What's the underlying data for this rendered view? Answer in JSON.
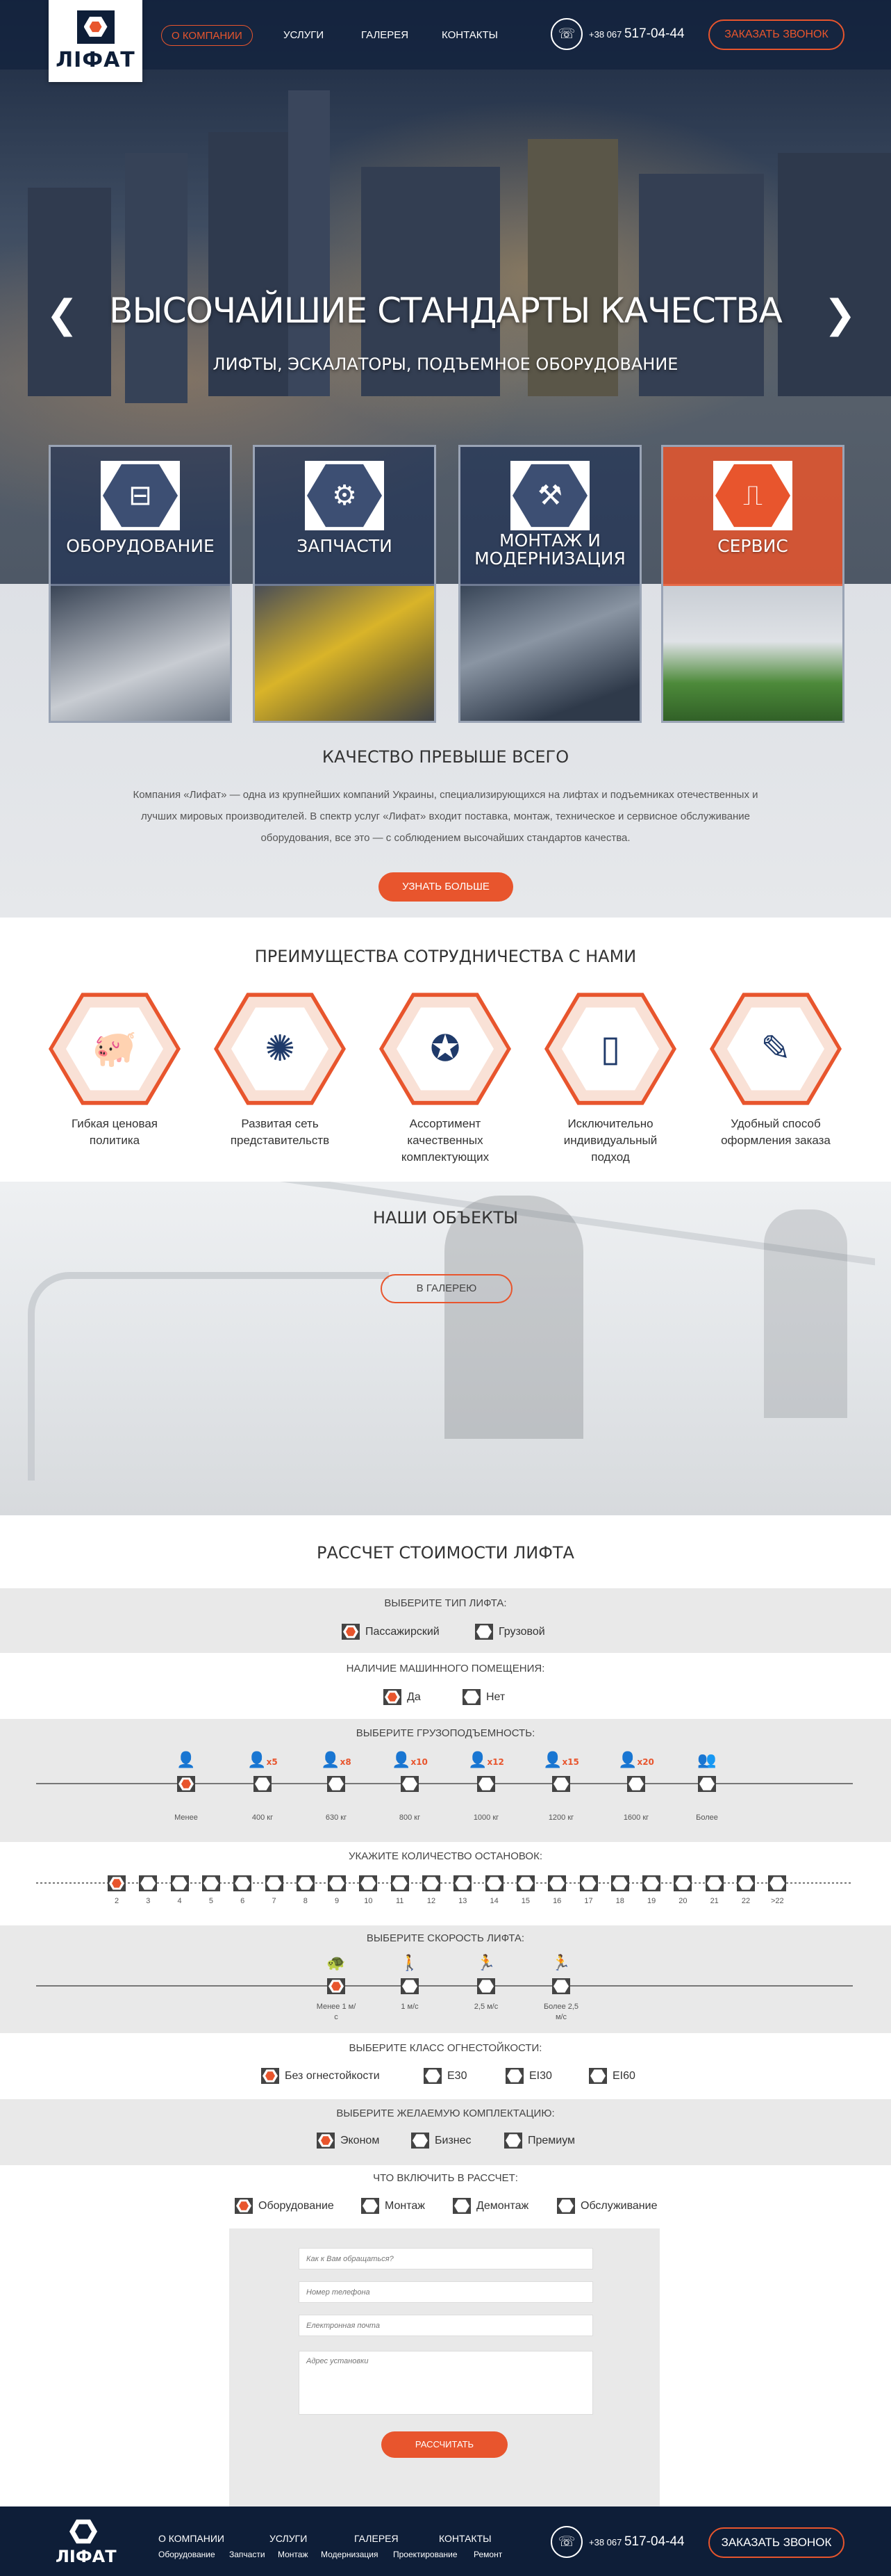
{
  "header": {
    "logo_text": "ЛІФАТ",
    "nav": [
      "О КОМПАНИИ",
      "УСЛУГИ",
      "ГАЛЕРЕЯ",
      "КОНТАКТЫ"
    ],
    "phone_prefix": "+38 067",
    "phone_number": "517-04-44",
    "call_button": "ЗАКАЗАТЬ ЗВОНОК"
  },
  "hero": {
    "title": "ВЫСОЧАЙШИЕ СТАНДАРТЫ КАЧЕСТВА",
    "subtitle": "ЛИФТЫ, ЭСКАЛАТОРЫ, ПОДЪЕМНОЕ ОБОРУДОВАНИЕ",
    "prev": "❮",
    "next": "❯"
  },
  "services": [
    {
      "label": "ОБОРУДОВАНИЕ",
      "icon": "elevator-icon"
    },
    {
      "label": "ЗАПЧАСТИ",
      "icon": "parts-icon"
    },
    {
      "label": "МОНТАЖ И МОДЕРНИЗАЦИЯ",
      "icon": "worker-icon"
    },
    {
      "label": "СЕРВИС",
      "icon": "multimeter-icon"
    }
  ],
  "quality": {
    "title": "КАЧЕСТВО ПРЕВЫШЕ ВСЕГО",
    "text": "Компания «Лифат» — одна из крупнейших компаний Украины, специализирующихся на лифтах и подъемниках отечественных и лучших мировых производителей. В спектр услуг «Лифат» входит поставка, монтаж, техническое и сервисное обслуживание оборудования, все это — с соблюдением высочайших стандартов качества.",
    "button": "УЗНАТЬ БОЛЬШЕ"
  },
  "advantages": {
    "title": "ПРЕИМУЩЕСТВА СОТРУДНИЧЕСТВА С НАМИ",
    "items": [
      {
        "label": "Гибкая ценовая политика",
        "icon": "piggy-bank-icon"
      },
      {
        "label": "Развитая сеть представительств",
        "icon": "network-icon"
      },
      {
        "label": "Ассортимент качественных комплектующих",
        "icon": "award-icon"
      },
      {
        "label": "Исключительно индивидуальный подход",
        "icon": "person-device-icon"
      },
      {
        "label": "Удобный способ оформления заказа",
        "icon": "document-pen-icon"
      }
    ]
  },
  "objects": {
    "title": "НАШИ ОБЪЕКТЫ",
    "button": "В ГАЛЕРЕЮ"
  },
  "calc": {
    "title": "РАССЧЕТ СТОИМОСТИ ЛИФТА",
    "type": {
      "label": "ВЫБЕРИТЕ ТИП ЛИФТА:",
      "options": [
        "Пассажирский",
        "Грузовой"
      ]
    },
    "machine_room": {
      "label": "НАЛИЧИЕ МАШИННОГО ПОМЕЩЕНИЯ:",
      "options": [
        "Да",
        "Нет"
      ]
    },
    "capacity": {
      "label": "ВЫБЕРИТЕ ГРУЗОПОДЪЕМНОСТЬ:",
      "ticks": [
        "Менее",
        "400 кг",
        "630 кг",
        "800 кг",
        "1000 кг",
        "1200 кг",
        "1600 кг",
        "Более"
      ],
      "badges": [
        "",
        "x5",
        "x8",
        "x10",
        "x12",
        "x15",
        "x20",
        ""
      ]
    },
    "stops": {
      "label": "УКАЖИТЕ КОЛИЧЕСТВО ОСТАНОВОК:",
      "ticks": [
        "2",
        "3",
        "4",
        "5",
        "6",
        "7",
        "8",
        "9",
        "10",
        "11",
        "12",
        "13",
        "14",
        "15",
        "16",
        "17",
        "18",
        "19",
        "20",
        "21",
        "22",
        ">22"
      ]
    },
    "speed": {
      "label": "ВЫБЕРИТЕ СКОРОСТЬ ЛИФТА:",
      "ticks": [
        "Менее 1 м/с",
        "1 м/с",
        "2,5 м/с",
        "Более 2,5 м/с"
      ]
    },
    "fire": {
      "label": "ВЫБЕРИТЕ КЛАСС ОГНЕСТОЙКОСТИ:",
      "options": [
        "Без огнестойкости",
        "E30",
        "EI30",
        "EI60"
      ]
    },
    "package": {
      "label": "ВЫБЕРИТЕ ЖЕЛАЕМУЮ КОМПЛЕКТАЦИЮ:",
      "options": [
        "Эконом",
        "Бизнес",
        "Премиум"
      ]
    },
    "include": {
      "label": "ЧТО ВКЛЮЧИТЬ В РАССЧЕТ:",
      "options": [
        "Оборудование",
        "Монтаж",
        "Демонтаж",
        "Обслуживание"
      ]
    }
  },
  "form": {
    "name_placeholder": "Как к Вам обращаться?",
    "phone_placeholder": "Номер телефона",
    "email_placeholder": "Електронная почта",
    "address_placeholder": "Адрес установки",
    "submit": "РАССЧИТАТЬ"
  },
  "footer": {
    "logo_text": "ЛІФАТ",
    "nav": [
      "О КОМПАНИИ",
      "УСЛУГИ",
      "ГАЛЕРЕЯ",
      "КОНТАКТЫ"
    ],
    "sub": [
      "Оборудование",
      "Запчасти",
      "Монтаж",
      "Модернизация",
      "Проектирование",
      "Ремонт"
    ],
    "phone_prefix": "+38 067",
    "phone_number": "517-04-44",
    "call_button": "ЗАКАЗАТЬ ЗВОНОК"
  },
  "colors": {
    "accent": "#e8552d",
    "navy": "#0e1e38"
  }
}
